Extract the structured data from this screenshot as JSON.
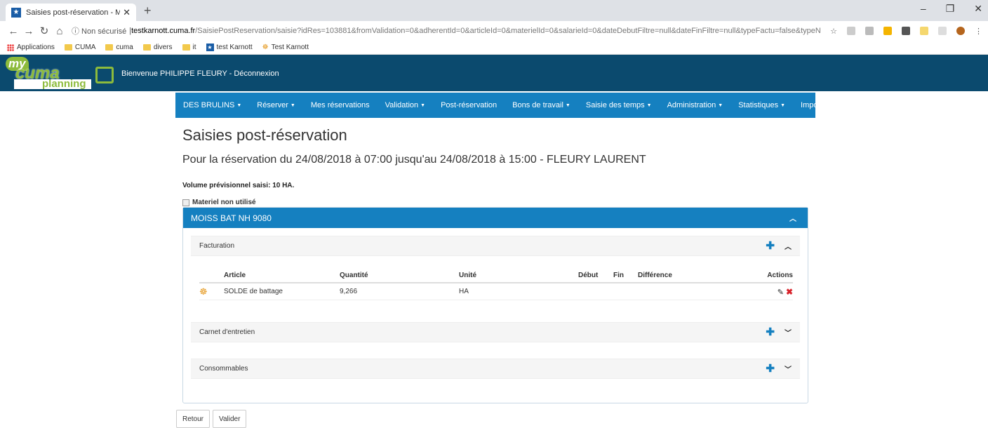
{
  "browser": {
    "tab_title": "Saisies post-réservation - MyCum",
    "url_security": "ⓘ Non sécurisé",
    "url_host": "testkarnott.cuma.fr",
    "url_path": "/SaisiePostReservation/saisie?idRes=103881&fromValidation=0&adherentId=0&articleId=0&materielId=0&salarieId=0&dateDebutFiltre=null&dateFinFiltre=null&typeFactu=false&typeNonFact...",
    "bookmarks": [
      "Applications",
      "CUMA",
      "cuma",
      "divers",
      "it",
      "test Karnott",
      "Test Karnott"
    ]
  },
  "header": {
    "logo_my": "my",
    "logo_cuma": "cuma",
    "logo_planning": "planning",
    "welcome": "Bienvenue PHILIPPE FLEURY - Déconnexion"
  },
  "nav": {
    "items": [
      {
        "label": "DES BRULINS",
        "dropdown": true
      },
      {
        "label": "Réserver",
        "dropdown": true
      },
      {
        "label": "Mes réservations",
        "dropdown": false
      },
      {
        "label": "Validation",
        "dropdown": true
      },
      {
        "label": "Post-réservation",
        "dropdown": false
      },
      {
        "label": "Bons de travail",
        "dropdown": true
      },
      {
        "label": "Saisie des temps",
        "dropdown": true
      },
      {
        "label": "Administration",
        "dropdown": true
      },
      {
        "label": "Statistiques",
        "dropdown": true
      },
      {
        "label": "Import Karnott",
        "dropdown": true
      }
    ]
  },
  "page": {
    "title": "Saisies post-réservation",
    "subtitle": "Pour la réservation du 24/08/2018 à 07:00 jusqu'au 24/08/2018 à 15:00 - FLEURY LAURENT",
    "volume": "Volume prévisionnel saisi: 10 HA.",
    "unused_label": "Materiel non utilisé"
  },
  "panel": {
    "title": "MOISS BAT NH 9080",
    "sections": {
      "facturation": "Facturation",
      "carnet": "Carnet d'entretien",
      "consommables": "Consommables"
    },
    "table": {
      "headers": {
        "article": "Article",
        "quantite": "Quantité",
        "unite": "Unité",
        "debut": "Début",
        "fin": "Fin",
        "difference": "Différence",
        "actions": "Actions"
      },
      "rows": [
        {
          "article": "SOLDE de battage",
          "quantite": "9,266",
          "unite": "HA",
          "debut": "",
          "fin": "",
          "difference": ""
        }
      ]
    }
  },
  "buttons": {
    "retour": "Retour",
    "valider": "Valider"
  },
  "colors": {
    "header": "#0b4a6e",
    "nav": "#1580c0",
    "accent_green": "#8dbb3c"
  }
}
